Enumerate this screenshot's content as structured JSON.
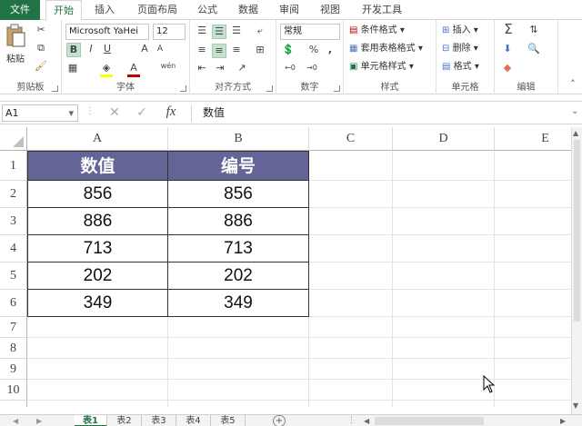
{
  "ribbon_tabs": [
    "文件",
    "开始",
    "插入",
    "页面布局",
    "公式",
    "数据",
    "审阅",
    "视图",
    "开发工具"
  ],
  "ribbon": {
    "clipboard": {
      "label": "剪贴板",
      "paste": "粘贴"
    },
    "font": {
      "label": "字体",
      "font_name": "Microsoft YaHei",
      "font_size": "12",
      "bold": "B",
      "italic": "I",
      "underline": "U",
      "grow": "A",
      "shrink": "A",
      "wen": "wén"
    },
    "alignment": {
      "label": "对齐方式"
    },
    "number": {
      "label": "数字",
      "format": "常规",
      "percent": "%",
      "comma": ","
    },
    "styles": {
      "label": "样式",
      "conditional": "条件格式",
      "table": "套用表格格式",
      "cell_styles": "单元格样式"
    },
    "cells": {
      "label": "单元格",
      "insert": "插入",
      "delete": "删除",
      "format": "格式"
    },
    "editing": {
      "label": "编辑"
    }
  },
  "formula_bar": {
    "name_box": "A1",
    "fx": "fx",
    "content": "数值"
  },
  "columns": [
    "A",
    "B",
    "C",
    "D",
    "E"
  ],
  "rows": [
    "1",
    "2",
    "3",
    "4",
    "5",
    "6",
    "7",
    "8",
    "9",
    "10"
  ],
  "table": {
    "headers": [
      "数值",
      "编号"
    ],
    "data": [
      [
        "856",
        "856"
      ],
      [
        "886",
        "886"
      ],
      [
        "713",
        "713"
      ],
      [
        "202",
        "202"
      ],
      [
        "349",
        "349"
      ]
    ]
  },
  "sheets": [
    "表1",
    "表2",
    "表3",
    "表4",
    "表5"
  ],
  "colors": {
    "accent": "#217346",
    "header_fill": "#646496"
  }
}
